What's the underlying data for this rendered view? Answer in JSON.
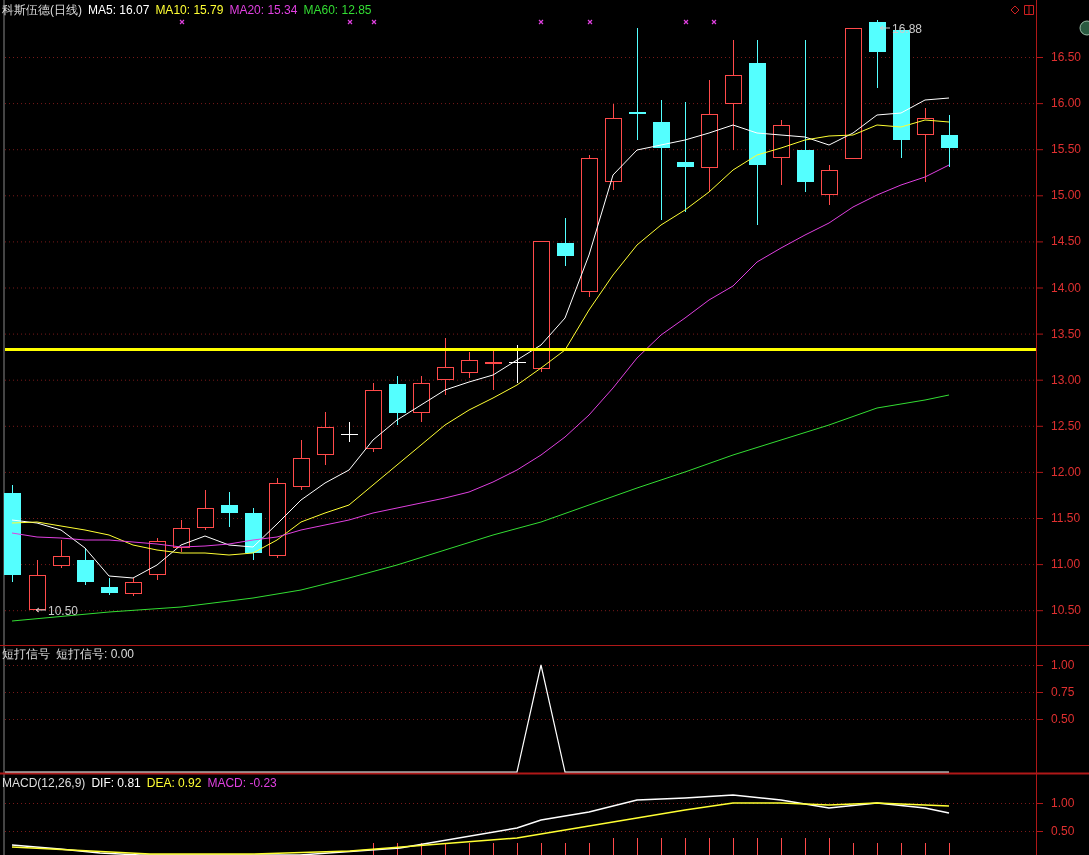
{
  "header": {
    "title": "科斯伍德(日线)",
    "indicators": [
      {
        "text": "MA5: 16.07",
        "color": "#ffffff"
      },
      {
        "text": "MA10: 15.79",
        "color": "#ffff33"
      },
      {
        "text": "MA20: 15.34",
        "color": "#e040e0"
      },
      {
        "text": "MA60: 12.85",
        "color": "#33dd33"
      }
    ]
  },
  "price_axis": {
    "ticks": [
      "16.50",
      "16.00",
      "15.50",
      "15.00",
      "14.50",
      "14.00",
      "13.50",
      "13.00",
      "12.50",
      "12.00",
      "11.50",
      "11.00",
      "10.50"
    ]
  },
  "price_markers": {
    "high": "16.88",
    "low": "10.50"
  },
  "signal_panel": {
    "title": "短打信号",
    "reading": "短打信号: 0.00",
    "ticks": [
      "1.00",
      "0.75",
      "0.50"
    ]
  },
  "macd_panel": {
    "title": "MACD(12,26,9)",
    "indicators": [
      {
        "text": "DIF: 0.81",
        "color": "#ffffff"
      },
      {
        "text": "DEA: 0.92",
        "color": "#ffff33"
      },
      {
        "text": "MACD: -0.23",
        "color": "#e040e0"
      }
    ],
    "ticks": [
      "1.00",
      "0.50"
    ]
  }
}
